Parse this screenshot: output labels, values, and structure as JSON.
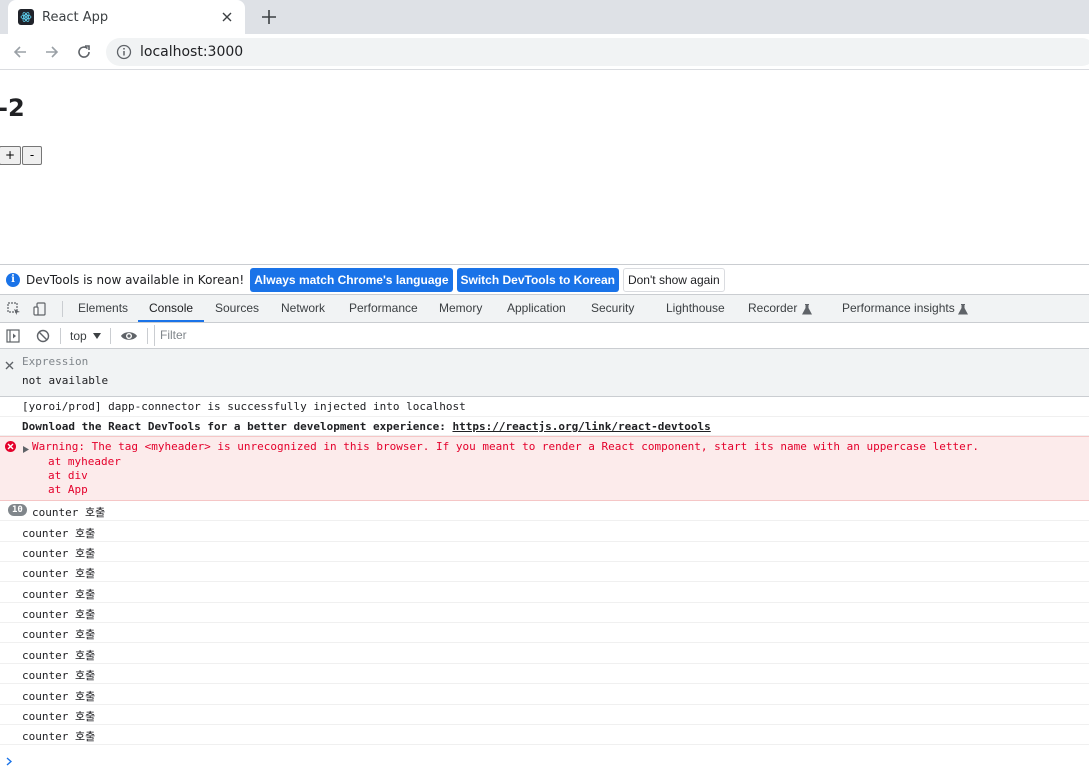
{
  "browser": {
    "tab_title": "React App",
    "url": "localhost:3000"
  },
  "page": {
    "counter_value": "-2",
    "plus_label": "+",
    "minus_label": "-"
  },
  "devtools": {
    "infobar": {
      "message": "DevTools is now available in Korean!",
      "btn_match": "Always match Chrome's language",
      "btn_switch": "Switch DevTools to Korean",
      "btn_dismiss": "Don't show again"
    },
    "tabs": [
      "Elements",
      "Console",
      "Sources",
      "Network",
      "Performance",
      "Memory",
      "Application",
      "Security",
      "Lighthouse",
      "Recorder",
      "Performance insights"
    ],
    "active_tab": "Console",
    "console_toolbar": {
      "context": "top",
      "filter_placeholder": "Filter"
    },
    "live_expression": {
      "label": "Expression",
      "value": "not available"
    },
    "messages": {
      "yoroi": "[yoroi/prod] dapp-connector is successfully injected into localhost",
      "devtools_prefix": "Download the React DevTools for a better development experience: ",
      "devtools_link": "https://reactjs.org/link/react-devtools",
      "warning": "Warning: The tag <myheader> is unrecognized in this browser. If you meant to render a React component, start its name with an uppercase letter.",
      "stack": [
        "at myheader",
        "at div",
        "at App"
      ],
      "repeat_count": "10",
      "counter_log": "counter 호출"
    }
  },
  "colors": {
    "accent": "#1a73e8",
    "error_bg": "#fcebeb",
    "error_text": "#e4002b"
  }
}
